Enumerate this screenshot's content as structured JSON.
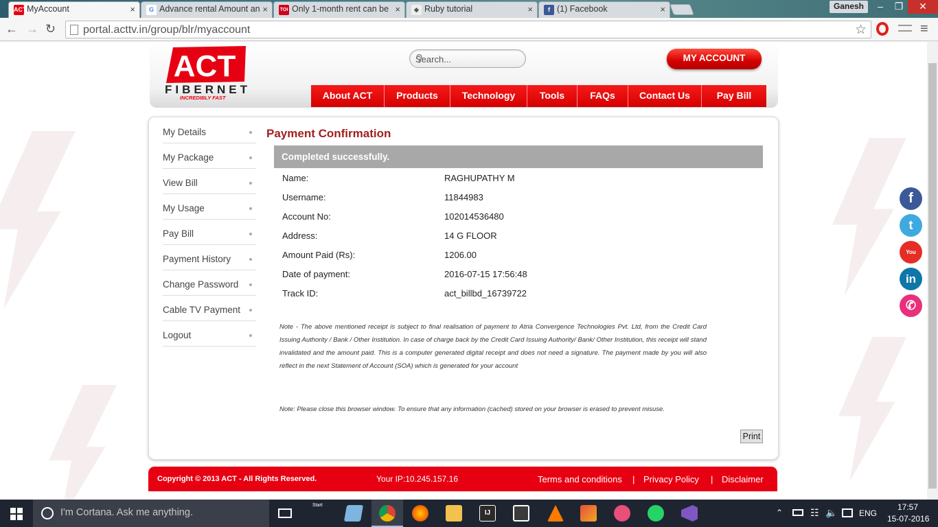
{
  "browser": {
    "tabs": [
      {
        "title": "MyAccount",
        "icon": "act-favicon"
      },
      {
        "title": "Advance rental Amount an",
        "icon": "google-favicon"
      },
      {
        "title": "Only 1-month rent can be",
        "icon": "toi-favicon"
      },
      {
        "title": "Ruby tutorial",
        "icon": "ruby-favicon"
      },
      {
        "title": "(1) Facebook",
        "icon": "facebook-favicon"
      }
    ],
    "favicon_text": {
      "act": "ACT",
      "google": "G",
      "toi": "TOI",
      "ruby": "◆",
      "facebook": "f"
    },
    "tab_close": "×",
    "user": "Ganesh",
    "url": "portal.acttv.in/group/blr/myaccount",
    "window_buttons": {
      "minimize": "–",
      "restore": "❐",
      "close": "✕"
    },
    "nav_glyphs": {
      "back": "←",
      "forward": "→",
      "reload": "↻",
      "star": "☆",
      "menu": "≡"
    }
  },
  "site": {
    "logo": {
      "act": "ACT",
      "fibernet": "FIBERNET",
      "tagline": "INCREDIBLY FAST"
    },
    "search_placeholder": "Search...",
    "my_account": "MY ACCOUNT",
    "nav": [
      "About ACT",
      "Products",
      "Technology",
      "Tools",
      "FAQs",
      "Contact Us",
      "Pay Bill"
    ]
  },
  "sidebar": [
    "My Details",
    "My Package",
    "View Bill",
    "My Usage",
    "Pay Bill",
    "Payment History",
    "Change Password",
    "Cable TV Payment",
    "Logout"
  ],
  "confirmation": {
    "title": "Payment Confirmation",
    "status": "Completed successfully.",
    "rows": [
      {
        "label": "Name:",
        "value": "RAGHUPATHY M"
      },
      {
        "label": "Username:",
        "value": "11844983"
      },
      {
        "label": "Account No:",
        "value": "102014536480"
      },
      {
        "label": "Address:",
        "value": "14 G FLOOR"
      },
      {
        "label": "Amount Paid (Rs):",
        "value": "1206.00"
      },
      {
        "label": "Date of payment:",
        "value": "2016-07-15 17:56:48"
      },
      {
        "label": "Track ID:",
        "value": "act_billbd_16739722"
      }
    ],
    "note1": "Note - The above mentioned receipt is subject to final realisation of payment to Atria Convergence Technologies Pvt. Ltd, from the Credit Card Issuing Authority / Bank / Other Institution. In case of charge back by the Credit Card Issuing Authority/ Bank/ Other Institution, this receipt will stand invalidated and the amount paid. This is a computer generated digital receipt and does not need a signature. The payment made by you will also reflect in the next Statement of Account (SOA) which is generated for your account",
    "note2": "Note: Please close this browser window. To ensure that any information (cached) stored on your browser is erased to prevent misuse.",
    "print": "Print"
  },
  "footer": {
    "copyright": "Copyright © 2013 ACT - All Rights Reserved.",
    "ip": "Your IP:10.245.157.16",
    "links": [
      "Terms and conditions",
      "Privacy Policy",
      "Disclaimer"
    ],
    "separator": "|"
  },
  "social": [
    {
      "name": "facebook",
      "glyph": "f",
      "color": "#3b5998"
    },
    {
      "name": "twitter",
      "glyph": "t",
      "color": "#3fa9e0"
    },
    {
      "name": "youtube",
      "glyph": "You Tube",
      "color": "#e52d27"
    },
    {
      "name": "linkedin",
      "glyph": "in",
      "color": "#0e76a8"
    },
    {
      "name": "phone",
      "glyph": "✆",
      "color": "#e8317a"
    }
  ],
  "taskbar": {
    "cortana": "I'm Cortana. Ask me anything.",
    "start_label": "Start",
    "lang": "ENG",
    "time": "17:57",
    "date": "15-07-2016",
    "app_colors": [
      "#cfd8e0",
      "#7fb3e0",
      "#e8a62e",
      "#ff6a00",
      "#f2c14e",
      "#2a2a2a",
      "#3b3b3b",
      "#ff7b00",
      "#e5503b",
      "#e84f7a",
      "#25d366",
      "#7e57c2"
    ]
  }
}
